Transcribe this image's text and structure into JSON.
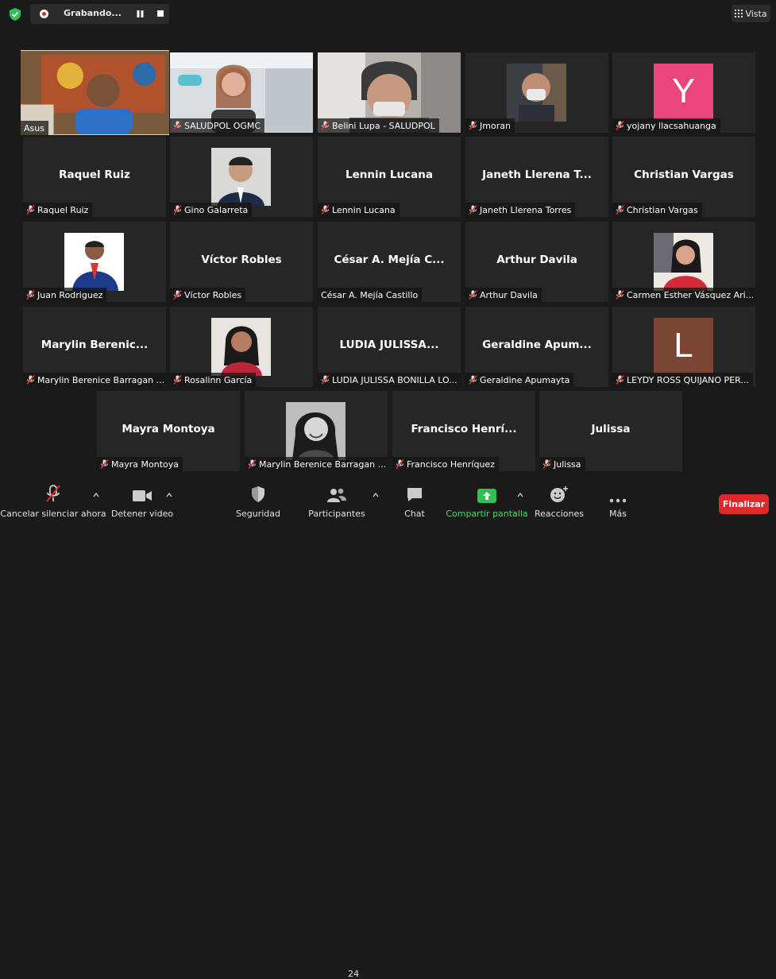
{
  "recording": {
    "label": "Grabando..."
  },
  "view_button": {
    "label": "Vista"
  },
  "participants": [
    {
      "tile_text": "",
      "label": "Asus",
      "muted": false,
      "kind": "video"
    },
    {
      "tile_text": "",
      "label": "SALUDPOL OGMC",
      "muted": true,
      "kind": "video"
    },
    {
      "tile_text": "",
      "label": "Belini Lupa - SALUDPOL",
      "muted": true,
      "kind": "video"
    },
    {
      "tile_text": "",
      "label": "Jmoran",
      "muted": true,
      "kind": "photo"
    },
    {
      "tile_text": "Y",
      "label": "yojany llacsahuanga",
      "muted": true,
      "kind": "letter",
      "color": "#e8467c"
    },
    {
      "tile_text": "Raquel Ruiz",
      "label": "Raquel Ruiz",
      "muted": true,
      "kind": "name"
    },
    {
      "tile_text": "",
      "label": "Gino Galarreta",
      "muted": true,
      "kind": "photo"
    },
    {
      "tile_text": "Lennin Lucana",
      "label": "Lennin Lucana",
      "muted": true,
      "kind": "name"
    },
    {
      "tile_text": "Janeth Llerena T...",
      "label": "Janeth Llerena Torres",
      "muted": true,
      "kind": "name"
    },
    {
      "tile_text": "Christian Vargas",
      "label": "Christian Vargas",
      "muted": true,
      "kind": "name"
    },
    {
      "tile_text": "",
      "label": "Juan Rodriguez",
      "muted": true,
      "kind": "photo"
    },
    {
      "tile_text": "Víctor Robles",
      "label": "Víctor Robles",
      "muted": true,
      "kind": "name"
    },
    {
      "tile_text": "César A. Mejía C...",
      "label": "César A. Mejía Castillo",
      "muted": false,
      "kind": "name"
    },
    {
      "tile_text": "Arthur Davila",
      "label": "Arthur Davila",
      "muted": true,
      "kind": "name"
    },
    {
      "tile_text": "",
      "label": "Carmen Esther Vásquez Ari...",
      "muted": true,
      "kind": "photo"
    },
    {
      "tile_text": "Marylin  Berenic...",
      "label": "Marylin Berenice Barragan ...",
      "muted": true,
      "kind": "name"
    },
    {
      "tile_text": "",
      "label": "Rosalinn García",
      "muted": true,
      "kind": "photo"
    },
    {
      "tile_text": "LUDIA  JULISSA...",
      "label": "LUDIA JULISSA BONILLA LO...",
      "muted": true,
      "kind": "name"
    },
    {
      "tile_text": "Geraldine  Apum...",
      "label": "Geraldine Apumayta",
      "muted": true,
      "kind": "name"
    },
    {
      "tile_text": "L",
      "label": "LEYDY ROSS QUIJANO PER...",
      "muted": true,
      "kind": "letter",
      "color": "#7a4535"
    },
    {
      "tile_text": "Mayra Montoya",
      "label": "Mayra Montoya",
      "muted": true,
      "kind": "name"
    },
    {
      "tile_text": "",
      "label": "Marylin Berenice Barragan ...",
      "muted": true,
      "kind": "photo"
    },
    {
      "tile_text": "Francisco  Henrí...",
      "label": "Francisco Henríquez",
      "muted": true,
      "kind": "name"
    },
    {
      "tile_text": "Julissa",
      "label": "Julissa",
      "muted": true,
      "kind": "name"
    }
  ],
  "toolbar": {
    "unmute": "Cancelar silenciar ahora",
    "stop_video": "Detener video",
    "security": "Seguridad",
    "participants": "Participantes",
    "participants_count": "24",
    "chat": "Chat",
    "share": "Compartir pantalla",
    "reactions": "Reacciones",
    "more": "Más",
    "end": "Finalizar"
  },
  "colors": {
    "active_speaker": "#d7ea55",
    "share_green": "#4cd964",
    "end_red": "#e02828"
  }
}
